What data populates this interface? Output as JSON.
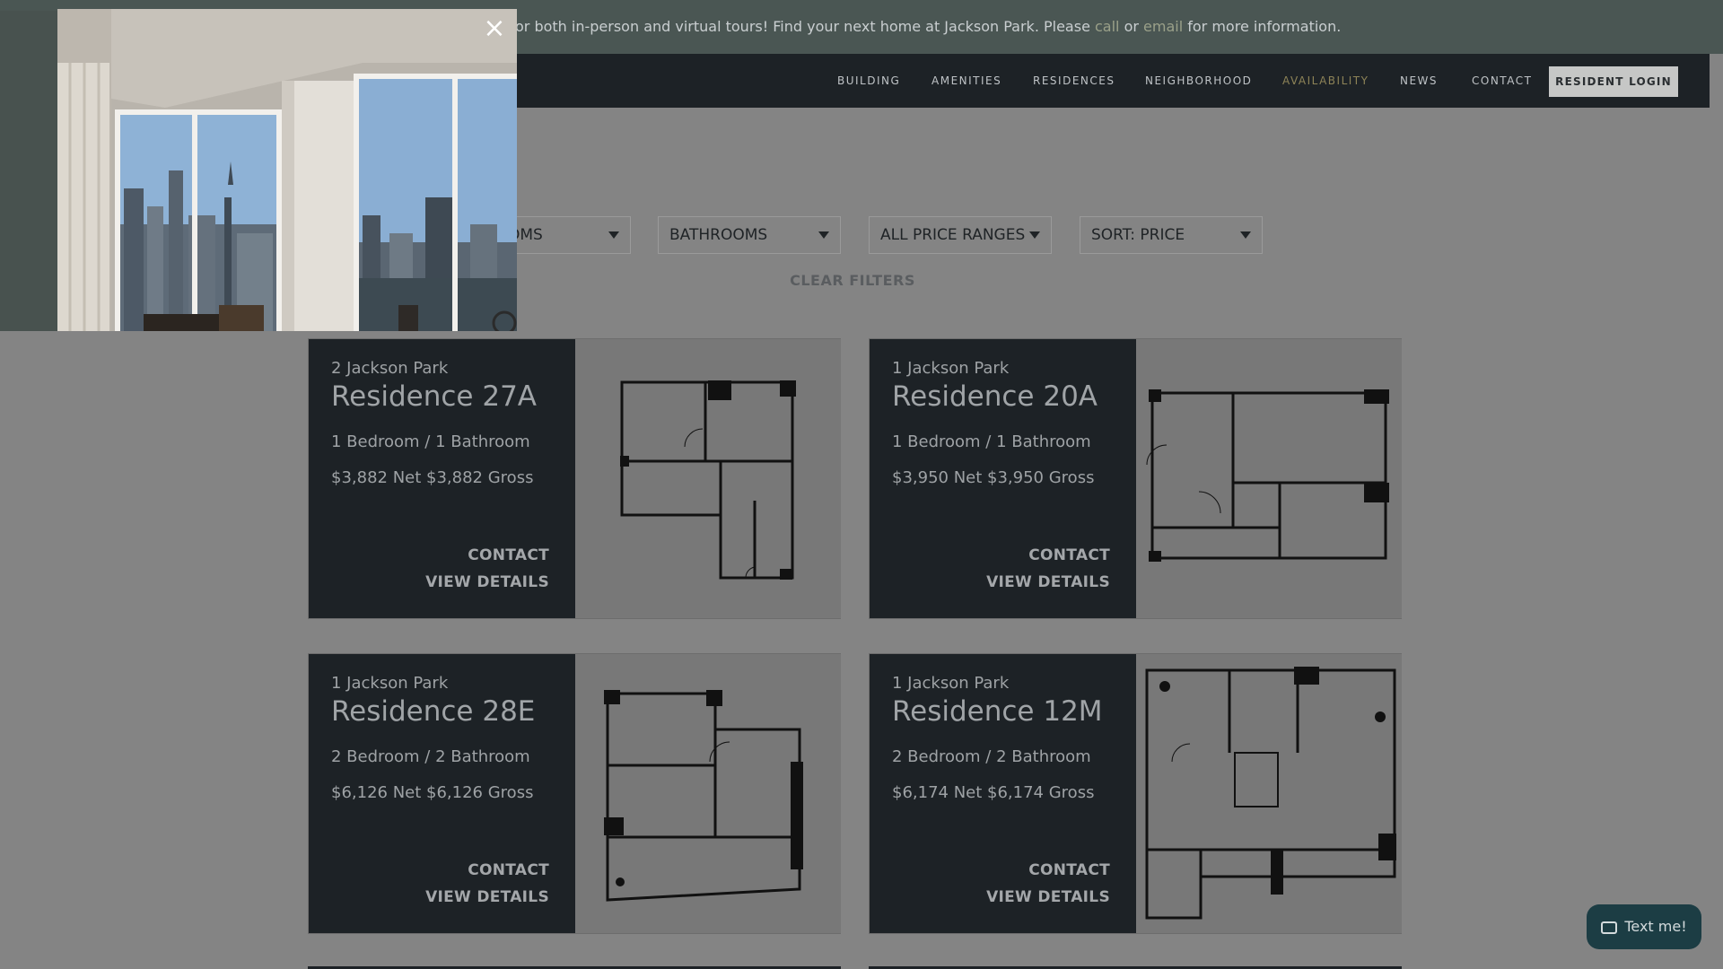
{
  "announcement": {
    "text_before": "or both in-person and virtual tours! Find your next home at Jackson Park. Please ",
    "call_link": "call",
    "or_text": " or ",
    "email_link": "email",
    "text_after": " for more information."
  },
  "nav": {
    "items": [
      {
        "label": "BUILDING"
      },
      {
        "label": "AMENITIES"
      },
      {
        "label": "RESIDENCES"
      },
      {
        "label": "NEIGHBORHOOD"
      },
      {
        "label": "AVAILABILITY",
        "active": true
      },
      {
        "label": "NEWS"
      },
      {
        "label": "CONTACT"
      }
    ],
    "resident_login": "RESIDENT LOGIN"
  },
  "filters": {
    "bedrooms": "OMS",
    "bathrooms": "BATHROOMS",
    "price": "ALL PRICE RANGES",
    "sort": "SORT: PRICE",
    "clear": "CLEAR FILTERS"
  },
  "listings": [
    {
      "building": "2 Jackson Park",
      "name": "Residence 27A",
      "bedbath": "1 Bedroom / 1 Bathroom",
      "price": "$3,882 Net $3,882 Gross",
      "contact": "CONTACT",
      "details": "VIEW DETAILS"
    },
    {
      "building": "1 Jackson Park",
      "name": "Residence 20A",
      "bedbath": "1 Bedroom / 1 Bathroom",
      "price": "$3,950 Net $3,950 Gross",
      "contact": "CONTACT",
      "details": "VIEW DETAILS"
    },
    {
      "building": "1 Jackson Park",
      "name": "Residence 28E",
      "bedbath": "2 Bedroom / 2 Bathroom",
      "price": "$6,126 Net $6,126 Gross",
      "contact": "CONTACT",
      "details": "VIEW DETAILS"
    },
    {
      "building": "1 Jackson Park",
      "name": "Residence 12M",
      "bedbath": "2 Bedroom / 2 Bathroom",
      "price": "$6,174 Net $6,174 Gross",
      "contact": "CONTACT",
      "details": "VIEW DETAILS"
    }
  ],
  "modal": {
    "close_icon": "close-icon",
    "close_glyph": "×"
  },
  "chat_widget": {
    "label": "Text me!",
    "icon": "chat-icon"
  },
  "colors": {
    "nav_bg": "#1d2226",
    "announce_bg": "#4a5653",
    "active_nav": "#8d8357",
    "page_bg": "#848484"
  }
}
